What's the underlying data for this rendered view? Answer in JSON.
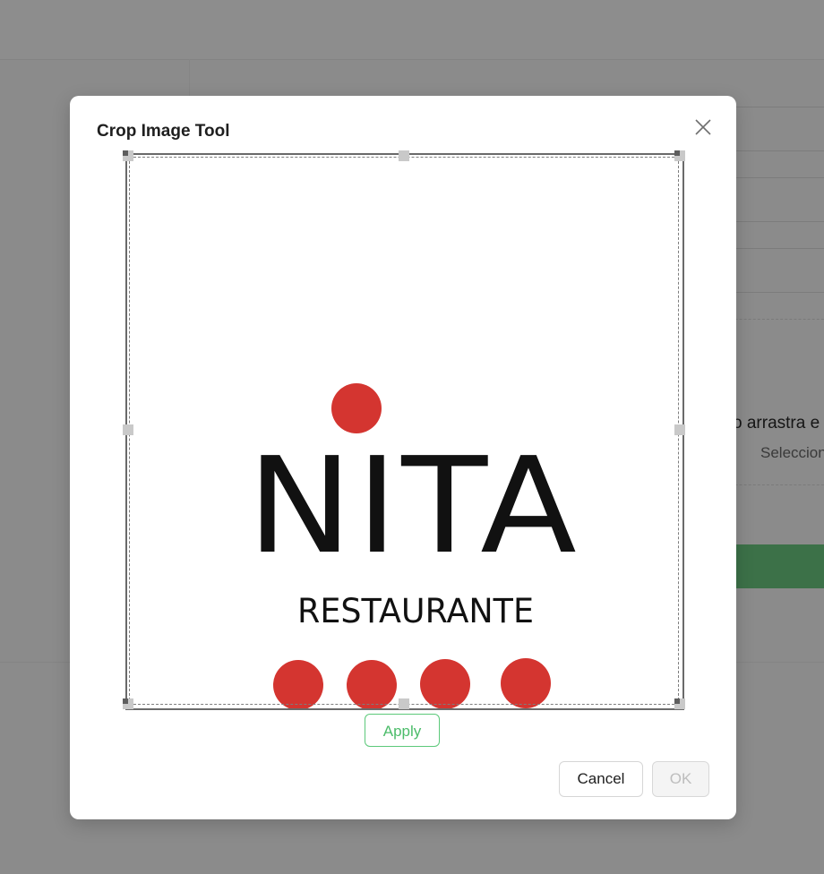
{
  "background": {
    "drag_text": "o arrastra e",
    "select_text": "Seleccion"
  },
  "modal": {
    "title": "Crop Image Tool",
    "close_icon": "close-icon",
    "image": {
      "brand_name": "NITA",
      "brand_sub": "RESTAURANTE",
      "dot_color": "#d43530",
      "text_color": "#111111"
    },
    "apply_label": "Apply",
    "cancel_label": "Cancel",
    "ok_label": "OK"
  },
  "colors": {
    "accent_green": "#4cbc6a",
    "overlay": "#8b8b8b"
  }
}
